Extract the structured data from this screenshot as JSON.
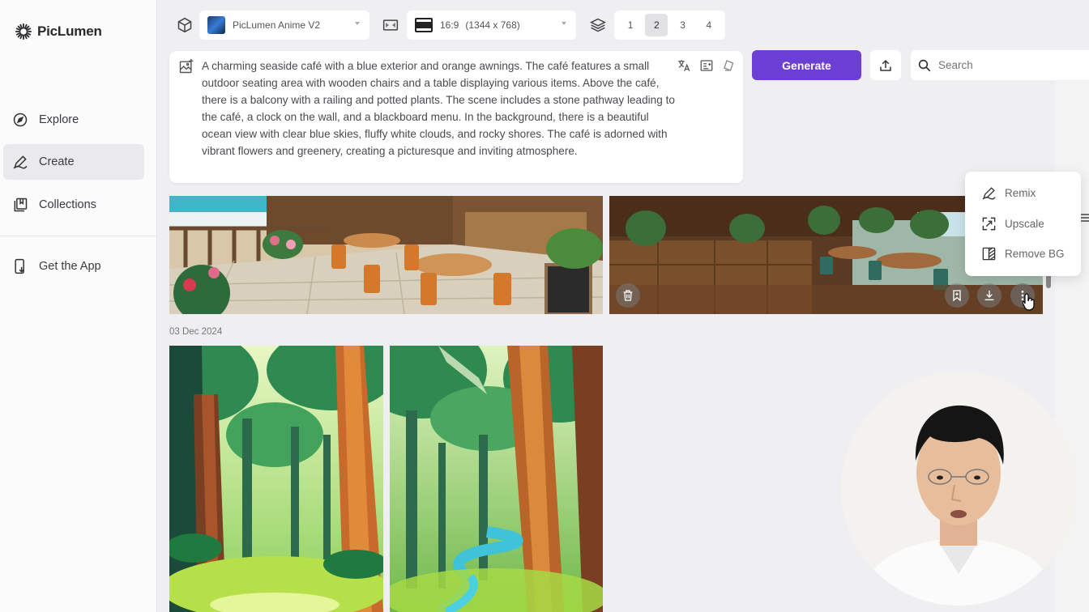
{
  "app": {
    "name": "PicLumen"
  },
  "sidebar": {
    "items": [
      {
        "label": "Explore",
        "icon": "compass-icon"
      },
      {
        "label": "Create",
        "icon": "pen-icon",
        "active": true
      },
      {
        "label": "Collections",
        "icon": "collections-icon"
      },
      {
        "label": "Get the App",
        "icon": "phone-icon"
      }
    ]
  },
  "toolbar": {
    "model": "PicLumen Anime V2",
    "aspect_ratio": "16:9",
    "resolution": "(1344 x 768)",
    "counts": [
      "1",
      "2",
      "3",
      "4"
    ],
    "selected_count": "2"
  },
  "prompt": {
    "text": "A charming seaside café with a blue exterior and orange awnings. The café features a small outdoor seating area with wooden chairs and a table displaying various items. Above the café, there is a balcony with a railing and potted plants. The scene includes a stone pathway leading to the café, a clock on the wall, and a blackboard menu. In the background, there is a beautiful ocean view with clear blue skies, fluffy white clouds, and rocky shores. The café is adorned with vibrant flowers and greenery, creating a picturesque and inviting atmosphere."
  },
  "actions": {
    "generate_label": "Generate",
    "search_placeholder": "Search"
  },
  "gallery": {
    "date_label": "03 Dec 2024"
  },
  "context_menu": {
    "items": [
      "Remix",
      "Upscale",
      "Remove BG"
    ]
  },
  "colors": {
    "accent": "#6b3fd4",
    "sidebar_bg": "#fbfbfc",
    "main_bg": "#efeff1"
  }
}
